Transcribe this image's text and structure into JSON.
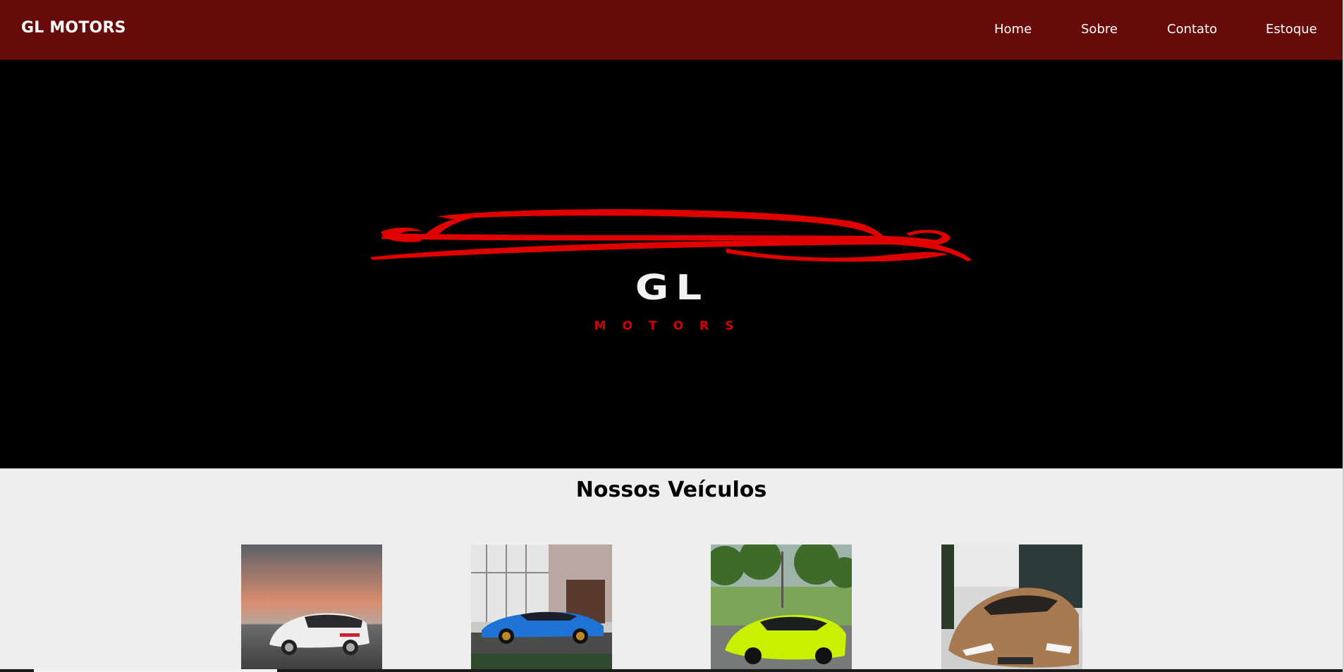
{
  "header": {
    "brand": "GL MOTORS",
    "nav": [
      {
        "label": "Home"
      },
      {
        "label": "Sobre"
      },
      {
        "label": "Contato"
      },
      {
        "label": "Estoque"
      }
    ]
  },
  "hero": {
    "logo_main": "GL",
    "logo_sub": "MOTORS"
  },
  "vehicles": {
    "title": "Nossos Veículos",
    "items": [
      {
        "image": "white-hatchback-sunset-photo"
      },
      {
        "image": "blue-sports-coupe-photo"
      },
      {
        "image": "lime-supercar-photo"
      },
      {
        "image": "bronze-supercar-photo"
      }
    ]
  },
  "colors": {
    "header_bg": "#660a0a",
    "hero_bg": "#000000",
    "logo_red": "#e00000",
    "page_bg": "#eeeeee"
  }
}
